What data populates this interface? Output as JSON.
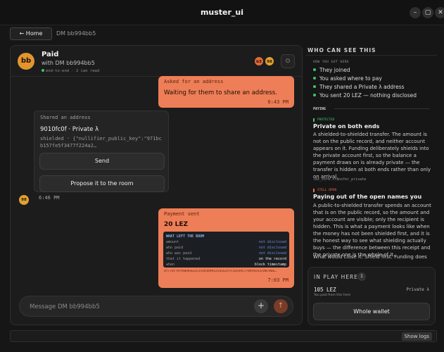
{
  "window": {
    "title": "muster_ui",
    "min": "–",
    "max": "▢",
    "close": "✕"
  },
  "nav": {
    "home_label": "← Home",
    "breadcrumb": "DM bb994bb5"
  },
  "chat": {
    "avatar": "bb",
    "title": "Paid",
    "subtitle": "with DM bb994bb5",
    "meta": "end-to-end · 2 can read",
    "participants": [
      "b3",
      "98"
    ],
    "head_icon": "⊙"
  },
  "messages": {
    "ask": {
      "tag": "Asked for an address",
      "text": "Waiting for them to share an address.",
      "time": "6:43 PM"
    },
    "share": {
      "tag": "Shared an address",
      "title": "9010fc0f · Private λ",
      "detail_1": "shielded · {\"nullifier_public_key\":\"971bc",
      "detail_2": "b157fe5f3477f224a2…",
      "send_label": "Send",
      "propose_label": "Propose it to the room",
      "time": "6:46 PM",
      "avatar": "98"
    },
    "payment": {
      "tag": "Payment sent",
      "amount": "20 LEZ",
      "table_title": "WHAT LEFT THE ROOM",
      "rows": [
        {
          "k": "amount",
          "v": "not disclosed"
        },
        {
          "k": "who paid",
          "v": "not disclosed"
        },
        {
          "k": "who was paid",
          "v": "not disclosed"
        },
        {
          "k": "that it happened",
          "v": "on the record"
        },
        {
          "k": "when",
          "v": "block timestamp"
        }
      ],
      "hash": "af77af7979a69ea22c2ca91b99125a1625fc1ace9c7789592e2cd87466…",
      "time": "7:03 PM"
    }
  },
  "composer": {
    "placeholder": "Message DM bb994bb5",
    "plus": "+",
    "send": "↑"
  },
  "who": {
    "title": "WHO CAN SEE THIS",
    "how_label": "HOW YOU GOT HERE",
    "how_items": [
      "They joined",
      "You asked where to pay",
      "They shared a Private λ address",
      "You sent 20 LEZ — nothing disclosed"
    ],
    "paying_label": "PAYING",
    "protected": {
      "badge": "PROTECTED",
      "title": "Private on both ends",
      "body": "A shielded-to-shielded transfer. The amount is not on the public record, and neither account appears on it. Funding deliberately shields into the private account first, so the balance a payment draws on is already private — the transfer is hidden at both ends rather than only on arrival.",
      "code": "lez_core.transfer_private"
    },
    "still_open": {
      "badge": "STILL OPEN",
      "title": "Paying out of the open names you",
      "body": "A public-to-shielded transfer spends an account that is on the public record, so the amount and your account are visible; only the recipient is hidden. This is what a payment looks like when the money has not been shielded first, and it is the honest way to see what shielding actually buys — the difference between this receipt and the private one is the whole of it.",
      "close": "What would close it: Shield first. Funding does"
    }
  },
  "inplay": {
    "title": "IN PLAY HERE",
    "count": "1",
    "amount": "105 LEZ",
    "kind": "Private λ",
    "note": "You paid from this here",
    "wallet_label": "Whole wallet"
  },
  "logs": {
    "label": "Show logs"
  }
}
